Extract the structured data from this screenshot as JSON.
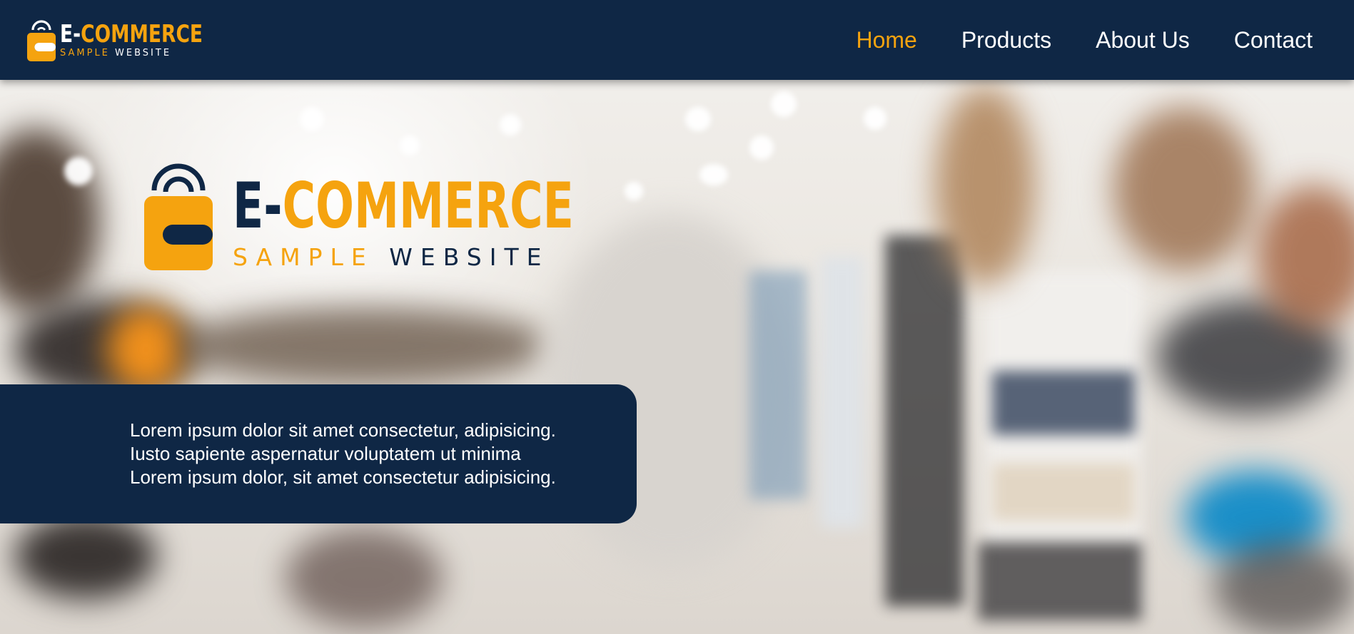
{
  "header": {
    "logo": {
      "brand_prefix": "E-",
      "brand_main": "COMMERCE",
      "sub_left": "SAMPLE",
      "sub_right": "WEBSITE",
      "icon": "shopping-bag-icon"
    },
    "nav": [
      {
        "label": "Home",
        "active": true
      },
      {
        "label": "Products",
        "active": false
      },
      {
        "label": "About Us",
        "active": false
      },
      {
        "label": "Contact",
        "active": false
      }
    ]
  },
  "hero": {
    "logo": {
      "brand_prefix": "E-",
      "brand_main": "COMMERCE",
      "sub_left": "SAMPLE",
      "sub_right": "WEBSITE",
      "icon": "shopping-bag-icon"
    },
    "description_lines": [
      "Lorem ipsum dolor sit amet consectetur, adipisicing.",
      "Iusto sapiente aspernatur voluptatem ut minima",
      "Lorem ipsum dolor, sit amet consectetur adipisicing."
    ]
  },
  "colors": {
    "navy": "#0f2745",
    "accent": "#f5a30f",
    "white": "#ffffff"
  }
}
